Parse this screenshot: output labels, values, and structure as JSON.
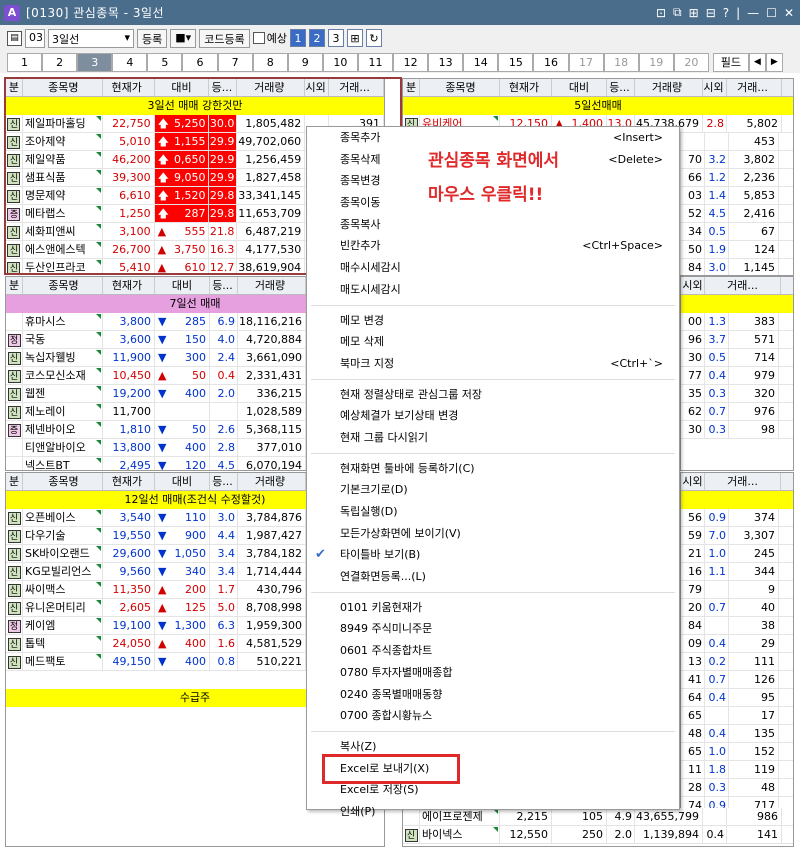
{
  "window": {
    "app_icon": "A",
    "title": "[0130] 관심종목 - 3일선",
    "controls": [
      "⊡",
      "⧉",
      "⊞",
      "⊟",
      "?",
      "|",
      "—",
      "☐",
      "✕"
    ]
  },
  "toolbar": {
    "group_num": "03",
    "group_name": "3일선",
    "register_label": "등록",
    "code_register_label": "코드등록",
    "checkbox_label": "예상",
    "page_buttons": [
      "1",
      "2",
      "3"
    ]
  },
  "tabs": [
    "1",
    "2",
    "3",
    "4",
    "5",
    "6",
    "7",
    "8",
    "9",
    "10",
    "11",
    "12",
    "13",
    "14",
    "15",
    "16",
    "17",
    "18",
    "19",
    "20"
  ],
  "field_label": "필드",
  "columns": [
    "분",
    "종목명",
    "현재가",
    "대비",
    "등...",
    "거래량",
    "시외",
    "거래..."
  ],
  "panels": {
    "p1": {
      "title": "3일선 매매 강한것만",
      "rows": [
        {
          "type": "신",
          "name": "제일파마홀딩",
          "price": "22,750",
          "chg": "5,250",
          "rate": "30.0",
          "vol": "1,805,482",
          "si": "",
          "tr": "391",
          "dir": "up"
        },
        {
          "type": "신",
          "name": "조아제약",
          "price": "5,010",
          "chg": "1,155",
          "rate": "29.9",
          "vol": "49,702,060",
          "si": "",
          "tr": "",
          "dir": "up"
        },
        {
          "type": "신",
          "name": "제일약품",
          "price": "46,200",
          "chg": "0,650",
          "rate": "29.9",
          "vol": "1,256,459",
          "si": "",
          "tr": "",
          "dir": "up"
        },
        {
          "type": "신",
          "name": "샘표식품",
          "price": "39,300",
          "chg": "9,050",
          "rate": "29.9",
          "vol": "1,827,458",
          "si": "",
          "tr": "",
          "dir": "up"
        },
        {
          "type": "신",
          "name": "명문제약",
          "price": "6,610",
          "chg": "1,520",
          "rate": "29.8",
          "vol": "33,341,145",
          "si": "",
          "tr": "",
          "dir": "up"
        },
        {
          "type": "증",
          "name": "메타랩스",
          "price": "1,250",
          "chg": "287",
          "rate": "29.8",
          "vol": "11,653,709",
          "si": "",
          "tr": "",
          "dir": "up"
        },
        {
          "type": "신",
          "name": "세화피앤씨",
          "price": "3,100",
          "chg": "555",
          "rate": "21.8",
          "vol": "6,487,219",
          "si": "",
          "tr": "",
          "dir": "up2"
        },
        {
          "type": "신",
          "name": "에스앤에스텍",
          "price": "26,700",
          "chg": "3,750",
          "rate": "16.3",
          "vol": "4,177,530",
          "si": "",
          "tr": "",
          "dir": "up2"
        },
        {
          "type": "신",
          "name": "두산인프라코",
          "price": "5,410",
          "chg": "610",
          "rate": "12.7",
          "vol": "38,619,904",
          "si": "",
          "tr": "",
          "dir": "up2"
        }
      ]
    },
    "p2": {
      "title": "7일선 매매",
      "rows": [
        {
          "type": "",
          "name": "휴마시스",
          "price": "3,800",
          "chg": "285",
          "rate": "6.9",
          "vol": "18,116,216",
          "dir": "down"
        },
        {
          "type": "정",
          "name": "국동",
          "price": "3,600",
          "chg": "150",
          "rate": "4.0",
          "vol": "4,720,884",
          "dir": "down"
        },
        {
          "type": "신",
          "name": "녹십자웰빙",
          "price": "11,900",
          "chg": "300",
          "rate": "2.4",
          "vol": "3,661,090",
          "dir": "down"
        },
        {
          "type": "신",
          "name": "코스모신소재",
          "price": "10,450",
          "chg": "50",
          "rate": "0.4",
          "vol": "2,331,431",
          "dir": "up2"
        },
        {
          "type": "신",
          "name": "웹젠",
          "price": "19,200",
          "chg": "400",
          "rate": "2.0",
          "vol": "336,215",
          "dir": "down"
        },
        {
          "type": "신",
          "name": "제노레이",
          "price": "11,700",
          "chg": "",
          "rate": "",
          "vol": "1,028,589",
          "dir": "none"
        },
        {
          "type": "증",
          "name": "제넨바이오",
          "price": "1,810",
          "chg": "50",
          "rate": "2.6",
          "vol": "5,368,115",
          "dir": "down"
        },
        {
          "type": "",
          "name": "티앤알바이오",
          "price": "13,800",
          "chg": "400",
          "rate": "2.8",
          "vol": "377,010",
          "dir": "down"
        },
        {
          "type": "",
          "name": "넥스트BT",
          "price": "2,495",
          "chg": "120",
          "rate": "4.5",
          "vol": "6,070,194",
          "dir": "down"
        }
      ]
    },
    "p3": {
      "title": "12일선 매매(조건식 수정할것)",
      "rows": [
        {
          "type": "신",
          "name": "오픈베이스",
          "price": "3,540",
          "chg": "110",
          "rate": "3.0",
          "vol": "3,784,876",
          "dir": "down"
        },
        {
          "type": "신",
          "name": "다우기술",
          "price": "19,550",
          "chg": "900",
          "rate": "4.4",
          "vol": "1,987,427",
          "dir": "down"
        },
        {
          "type": "신",
          "name": "SK바이오랜드",
          "price": "29,600",
          "chg": "1,050",
          "rate": "3.4",
          "vol": "3,784,182",
          "dir": "down"
        },
        {
          "type": "신",
          "name": "KG모빌리언스",
          "price": "9,560",
          "chg": "340",
          "rate": "3.4",
          "vol": "1,714,444",
          "dir": "down"
        },
        {
          "type": "신",
          "name": "싸이맥스",
          "price": "11,350",
          "chg": "200",
          "rate": "1.7",
          "vol": "430,796",
          "dir": "up2"
        },
        {
          "type": "신",
          "name": "유니온머티리",
          "price": "2,605",
          "chg": "125",
          "rate": "5.0",
          "vol": "8,708,998",
          "dir": "up2"
        },
        {
          "type": "정",
          "name": "케이엠",
          "price": "19,100",
          "chg": "1,300",
          "rate": "6.3",
          "vol": "1,959,300",
          "dir": "down"
        },
        {
          "type": "신",
          "name": "톱텍",
          "price": "24,050",
          "chg": "400",
          "rate": "1.6",
          "vol": "4,581,529",
          "dir": "up2"
        },
        {
          "type": "신",
          "name": "메드팩토",
          "price": "49,150",
          "chg": "400",
          "rate": "0.8",
          "vol": "510,221",
          "dir": "down"
        }
      ],
      "footer_title": "수급주"
    },
    "p4": {
      "title": "5일선매매",
      "rows": [
        {
          "name": "유비케어",
          "price": "12,150",
          "chg": "1,400",
          "rate": "13.0",
          "vol": "45,738,679",
          "si": "2.8",
          "tr": "5,802"
        }
      ]
    },
    "right_cols": [
      {
        "a": "",
        "si": "",
        "tr": "453"
      },
      {
        "a": "70",
        "si": "3.2",
        "tr": "3,802"
      },
      {
        "a": "66",
        "si": "1.2",
        "tr": "2,236"
      },
      {
        "a": "03",
        "si": "1.4",
        "tr": "5,853"
      },
      {
        "a": "52",
        "si": "4.5",
        "tr": "2,416"
      },
      {
        "a": "34",
        "si": "0.5",
        "tr": "67"
      },
      {
        "a": "50",
        "si": "1.9",
        "tr": "124"
      },
      {
        "a": "84",
        "si": "3.0",
        "tr": "1,145"
      }
    ],
    "right_cols2": [
      {
        "a": "00",
        "si": "1.3",
        "tr": "383"
      },
      {
        "a": "96",
        "si": "3.7",
        "tr": "571"
      },
      {
        "a": "30",
        "si": "0.5",
        "tr": "714"
      },
      {
        "a": "77",
        "si": "0.4",
        "tr": "979"
      },
      {
        "a": "35",
        "si": "0.3",
        "tr": "320"
      },
      {
        "a": "62",
        "si": "0.7",
        "tr": "976"
      },
      {
        "a": "30",
        "si": "0.3",
        "tr": "98"
      }
    ],
    "right_cols3": [
      {
        "a": "56",
        "si": "0.9",
        "tr": "374"
      },
      {
        "a": "59",
        "si": "7.0",
        "tr": "3,307"
      },
      {
        "a": "21",
        "si": "1.0",
        "tr": "245"
      },
      {
        "a": "16",
        "si": "1.1",
        "tr": "344"
      },
      {
        "a": "79",
        "si": "",
        "tr": "9"
      },
      {
        "a": "20",
        "si": "0.7",
        "tr": "40"
      },
      {
        "a": "84",
        "si": "",
        "tr": "38"
      },
      {
        "a": "09",
        "si": "0.4",
        "tr": "29"
      },
      {
        "a": "13",
        "si": "0.2",
        "tr": "111"
      },
      {
        "a": "41",
        "si": "0.7",
        "tr": "126"
      },
      {
        "a": "64",
        "si": "0.4",
        "tr": "95"
      },
      {
        "a": "65",
        "si": "",
        "tr": "17"
      },
      {
        "a": "48",
        "si": "0.4",
        "tr": "135"
      },
      {
        "a": "65",
        "si": "1.0",
        "tr": "152"
      },
      {
        "a": "11",
        "si": "1.8",
        "tr": "119"
      },
      {
        "a": "28",
        "si": "0.3",
        "tr": "48"
      },
      {
        "a": "74",
        "si": "0.9",
        "tr": "717"
      }
    ],
    "bottom_rows": [
      {
        "type": "",
        "name": "에이프로젠제",
        "price": "2,215",
        "chg": "105",
        "rate": "4.9",
        "vol": "43,655,799",
        "si": "",
        "tr": "986"
      },
      {
        "type": "신",
        "name": "바이넥스",
        "price": "12,550",
        "chg": "250",
        "rate": "2.0",
        "vol": "1,139,894",
        "si": "0.4",
        "tr": "141"
      }
    ]
  },
  "context_menu": {
    "items": [
      {
        "label": "종목추가",
        "shortcut": "<Insert>"
      },
      {
        "label": "종목삭제",
        "shortcut": "<Delete>"
      },
      {
        "label": "종목변경",
        "shortcut": ""
      },
      {
        "label": "종목이동",
        "shortcut": ""
      },
      {
        "label": "종목복사",
        "shortcut": ""
      },
      {
        "label": "빈칸추가",
        "shortcut": "<Ctrl+Space>"
      },
      {
        "label": "매수시세감시",
        "shortcut": ""
      },
      {
        "label": "매도시세감시",
        "shortcut": ""
      },
      {
        "sep": true
      },
      {
        "label": "메모 변경",
        "shortcut": ""
      },
      {
        "label": "메모 삭제",
        "shortcut": ""
      },
      {
        "label": "북마크 지정",
        "shortcut": "<Ctrl+`>"
      },
      {
        "sep": true
      },
      {
        "label": "현재 정렬상태로 관심그룹 저장",
        "shortcut": ""
      },
      {
        "label": "예상체결가 보기상태 변경",
        "shortcut": ""
      },
      {
        "label": "현재 그룹 다시읽기",
        "shortcut": ""
      },
      {
        "sep": true
      },
      {
        "label": "현재화면 툴바에 등록하기(C)",
        "shortcut": ""
      },
      {
        "label": "기본크기로(D)",
        "shortcut": ""
      },
      {
        "label": "독립실행(D)",
        "shortcut": ""
      },
      {
        "label": "모든가상화면에 보이기(V)",
        "shortcut": ""
      },
      {
        "label": "타이틀바 보기(B)",
        "shortcut": "",
        "checked": true
      },
      {
        "label": "연결화면등록...(L)",
        "shortcut": ""
      },
      {
        "sep": true
      },
      {
        "label": "0101 키움현재가",
        "shortcut": ""
      },
      {
        "label": "8949 주식미니주문",
        "shortcut": ""
      },
      {
        "label": "0601 주식종합차트",
        "shortcut": ""
      },
      {
        "label": "0780 투자자별매매종합",
        "shortcut": ""
      },
      {
        "label": "0240 종목별매매동향",
        "shortcut": ""
      },
      {
        "label": "0700 종합시황뉴스",
        "shortcut": ""
      },
      {
        "sep": true
      },
      {
        "label": "복사(Z)",
        "shortcut": ""
      },
      {
        "label": "Excel로 보내기(X)",
        "shortcut": ""
      },
      {
        "label": "Excel로 저장(S)",
        "shortcut": ""
      },
      {
        "label": "인쇄(P)",
        "shortcut": ""
      }
    ]
  },
  "annotation": {
    "line1": "관심종목 화면에서",
    "line2": "마우스 우클릭!!"
  },
  "colors": {
    "titlebar": "#4a6d8c",
    "accent_red": "#e0292a",
    "yellow": "#ffff00",
    "pink": "#e6a0e0"
  }
}
